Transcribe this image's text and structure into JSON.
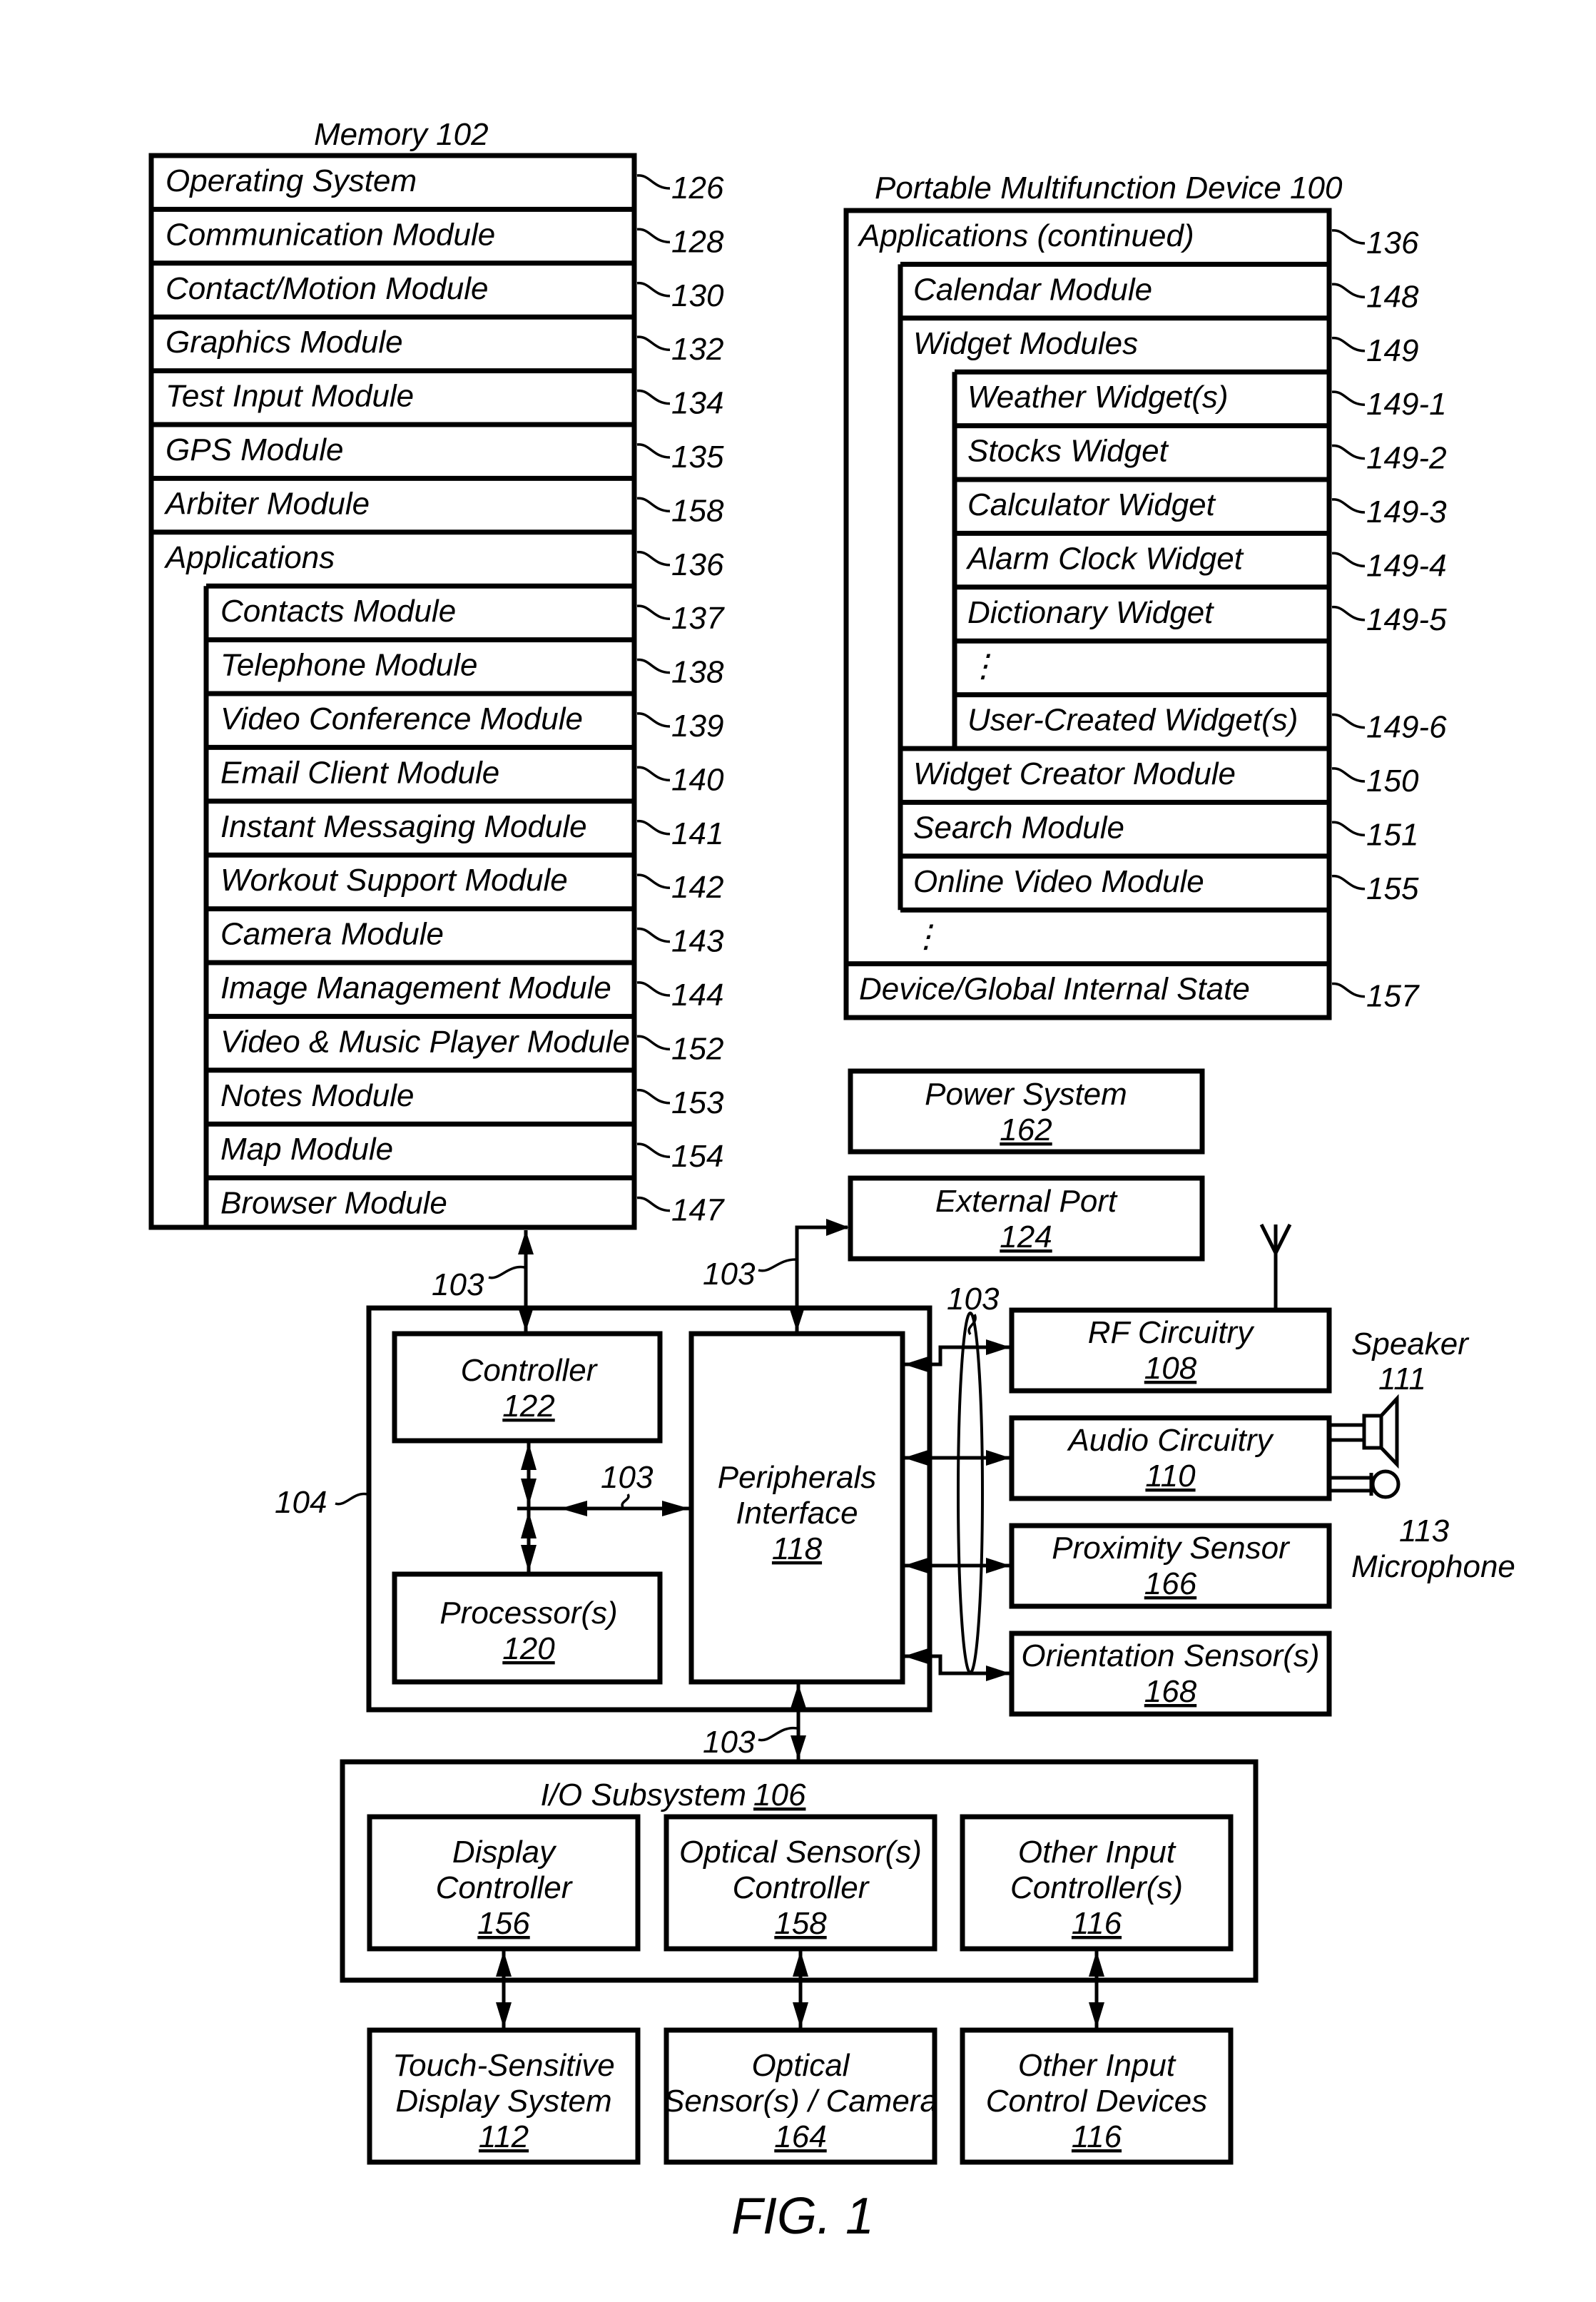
{
  "figure": {
    "caption": "FIG. 1",
    "bus_ref": "103"
  },
  "memory": {
    "title": "Memory 102",
    "rows": [
      {
        "label": "Operating System",
        "ref": "126"
      },
      {
        "label": "Communication Module",
        "ref": "128"
      },
      {
        "label": "Contact/Motion Module",
        "ref": "130"
      },
      {
        "label": "Graphics Module",
        "ref": "132"
      },
      {
        "label": "Test Input Module",
        "ref": "134"
      },
      {
        "label": "GPS Module",
        "ref": "135"
      },
      {
        "label": "Arbiter Module",
        "ref": "158"
      }
    ],
    "applications": {
      "label": "Applications",
      "ref": "136",
      "modules": [
        {
          "label": "Contacts Module",
          "ref": "137"
        },
        {
          "label": "Telephone Module",
          "ref": "138"
        },
        {
          "label": "Video Conference Module",
          "ref": "139"
        },
        {
          "label": "Email Client Module",
          "ref": "140"
        },
        {
          "label": "Instant Messaging Module",
          "ref": "141"
        },
        {
          "label": "Workout Support Module",
          "ref": "142"
        },
        {
          "label": "Camera Module",
          "ref": "143"
        },
        {
          "label": "Image Management Module",
          "ref": "144"
        },
        {
          "label": "Video & Music Player Module",
          "ref": "152"
        },
        {
          "label": "Notes Module",
          "ref": "153"
        },
        {
          "label": "Map Module",
          "ref": "154"
        },
        {
          "label": "Browser Module",
          "ref": "147"
        }
      ]
    }
  },
  "device": {
    "title": "Portable Multifunction Device 100",
    "applications_continued": {
      "label": "Applications (continued)",
      "ref": "136"
    },
    "calendar": {
      "label": "Calendar Module",
      "ref": "148"
    },
    "widget_modules": {
      "label": "Widget Modules",
      "ref": "149",
      "widgets": [
        {
          "label": "Weather Widget(s)",
          "ref": "149-1"
        },
        {
          "label": "Stocks Widget",
          "ref": "149-2"
        },
        {
          "label": "Calculator Widget",
          "ref": "149-3"
        },
        {
          "label": "Alarm Clock Widget",
          "ref": "149-4"
        },
        {
          "label": "Dictionary Widget",
          "ref": "149-5"
        },
        {
          "label": "⋮",
          "ref": ""
        },
        {
          "label": "User-Created Widget(s)",
          "ref": "149-6"
        }
      ]
    },
    "more_modules": [
      {
        "label": "Widget Creator Module",
        "ref": "150"
      },
      {
        "label": "Search Module",
        "ref": "151"
      },
      {
        "label": "Online Video Module",
        "ref": "155"
      }
    ],
    "ellipsis": "⋮",
    "state": {
      "label": "Device/Global Internal State",
      "ref": "157"
    }
  },
  "power": {
    "label": "Power System",
    "num": "162"
  },
  "external_port": {
    "label": "External Port",
    "num": "124"
  },
  "core": {
    "ref": "104",
    "controller": {
      "label": "Controller",
      "num": "122"
    },
    "processor": {
      "label": "Processor(s)",
      "num": "120"
    },
    "peripherals": {
      "line1": "Peripherals",
      "line2": "Interface",
      "num": "118"
    }
  },
  "peripheral_devices": [
    {
      "label": "RF Circuitry",
      "num": "108"
    },
    {
      "label": "Audio Circuitry",
      "num": "110"
    },
    {
      "label": "Proximity Sensor",
      "num": "166"
    },
    {
      "label": "Orientation Sensor(s)",
      "num": "168"
    }
  ],
  "speaker": {
    "label": "Speaker",
    "ref": "111"
  },
  "microphone": {
    "label": "Microphone",
    "ref": "113"
  },
  "io": {
    "title": "I/O Subsystem",
    "num": "106",
    "controllers": [
      {
        "line1": "Display",
        "line2": "Controller",
        "num": "156"
      },
      {
        "line1": "Optical Sensor(s)",
        "line2": "Controller",
        "num": "158"
      },
      {
        "line1": "Other Input",
        "line2": "Controller(s)",
        "num": "116"
      }
    ]
  },
  "devices_bottom": [
    {
      "line1": "Touch-Sensitive",
      "line2": "Display System",
      "num": "112"
    },
    {
      "line1": "Optical",
      "line2": "Sensor(s) / Camera",
      "num": "164"
    },
    {
      "line1": "Other Input",
      "line2": "Control Devices",
      "num": "116"
    }
  ]
}
